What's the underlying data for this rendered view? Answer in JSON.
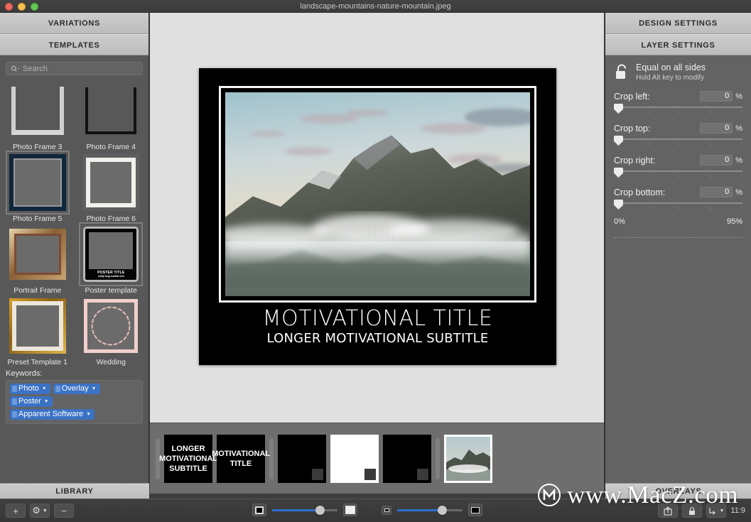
{
  "window": {
    "title": "landscape-mountains-nature-mountain.jpeg",
    "traffic_lights": [
      "close",
      "minimize",
      "zoom"
    ]
  },
  "left_panel": {
    "tabs": [
      {
        "label": "VARIATIONS"
      },
      {
        "label": "TEMPLATES"
      }
    ],
    "search": {
      "placeholder": "Search",
      "value": ""
    },
    "templates": [
      {
        "label": "Photo Frame 3",
        "selected": false
      },
      {
        "label": "Photo Frame 4",
        "selected": false
      },
      {
        "label": "Photo Frame 5",
        "selected": true
      },
      {
        "label": "Photo Frame 6",
        "selected": false
      },
      {
        "label": "Portrait Frame",
        "selected": false
      },
      {
        "label": "Poster template",
        "selected": true
      },
      {
        "label": "Preset Template 1",
        "selected": false
      },
      {
        "label": "Wedding",
        "selected": false
      }
    ],
    "poster_thumb": {
      "title": "POSTER TITLE",
      "subtitle": "really long subtitle text"
    },
    "keywords": {
      "title": "Keywords:",
      "tags": [
        "Photo",
        "Overlay",
        "Poster",
        "Apparent Software"
      ]
    },
    "library_button": "LIBRARY"
  },
  "canvas": {
    "poster": {
      "title": "MOTIVATIONAL TITLE",
      "subtitle": "LONGER MOTIVATIONAL SUBTITLE"
    }
  },
  "filmstrip": {
    "items": [
      {
        "type": "text",
        "text": "LONGER MOTIVATIONAL SUBTITLE",
        "selected": false
      },
      {
        "type": "text",
        "text": "MOTIVATIONAL TITLE",
        "selected": false
      },
      {
        "type": "black",
        "text": "",
        "selected": false
      },
      {
        "type": "white",
        "text": "",
        "selected": false
      },
      {
        "type": "black",
        "text": "",
        "selected": false
      },
      {
        "type": "photo",
        "text": "",
        "selected": true
      }
    ]
  },
  "right_panel": {
    "tabs": [
      {
        "label": "DESIGN SETTINGS"
      },
      {
        "label": "LAYER SETTINGS"
      }
    ],
    "lock": {
      "title": "Equal on all sides",
      "hint": "Hold Alt key to modify",
      "icon": "lock-open-icon"
    },
    "crops": [
      {
        "label": "Crop left:",
        "value": "0",
        "unit": "%",
        "position": 0
      },
      {
        "label": "Crop top:",
        "value": "0",
        "unit": "%",
        "position": 0
      },
      {
        "label": "Crop right:",
        "value": "0",
        "unit": "%",
        "position": 0
      },
      {
        "label": "Crop bottom:",
        "value": "0",
        "unit": "%",
        "position": 0
      }
    ],
    "range": {
      "min": "0%",
      "max": "95%"
    },
    "overlays_button": "OVERLAYS"
  },
  "bottom_bar": {
    "left_buttons": [
      {
        "icon": "plus-icon",
        "label": "+"
      },
      {
        "icon": "gear-icon",
        "label": "⚙"
      },
      {
        "icon": "minus-icon",
        "label": "−"
      }
    ],
    "sliders": [
      {
        "name": "border-size-slider",
        "value": 72
      },
      {
        "name": "zoom-slider",
        "value": 68
      }
    ],
    "ratio": "11:9",
    "right_buttons": [
      {
        "icon": "export-icon"
      },
      {
        "icon": "lock-icon"
      },
      {
        "icon": "resize-icon"
      }
    ]
  },
  "watermark": {
    "text": "www.MacZ.com",
    "logo": "macz-logo-icon"
  },
  "colors": {
    "accent": "#3b72c4",
    "slider_fill": "#2f6fd0",
    "panel_bg": "#636363",
    "left_panel_bg": "#585858",
    "canvas_bg": "#e0e0e0",
    "tab_bg": "#c5c5c5",
    "poster_bg": "#000000"
  }
}
